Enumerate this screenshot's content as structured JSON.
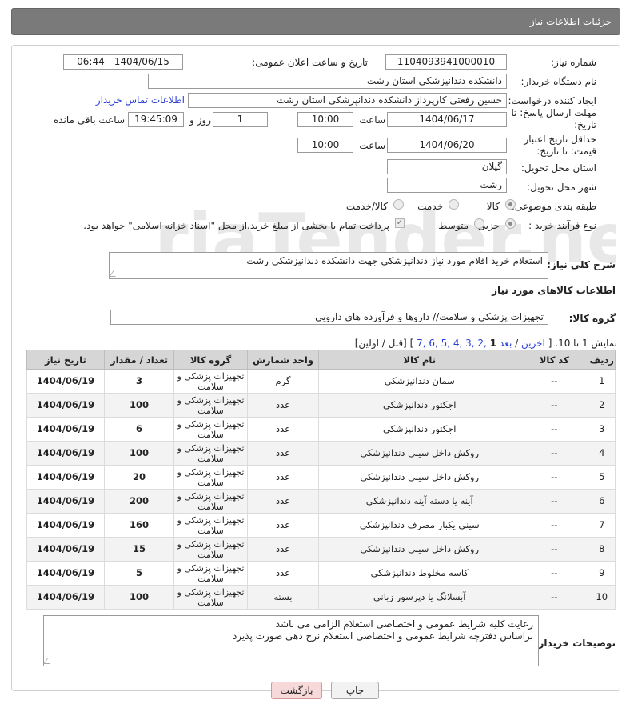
{
  "header": {
    "title": "جزئیات اطلاعات نیاز"
  },
  "form": {
    "need_number": {
      "label": "شماره نیاز:",
      "value": "1104093941000010"
    },
    "announce": {
      "label": "تاریخ و ساعت اعلان عمومی:",
      "value": "1404/06/15 - 06:44"
    },
    "buyer": {
      "label": "نام دستگاه خریدار:",
      "value": "دانشکده دندانپزشکی استان رشت"
    },
    "creator": {
      "label": "ایجاد کننده درخواست:",
      "value": "حسین رفعتی کارپرداز دانشکده دندانپزشکی استان رشت",
      "contact_link": "اطلاعات تماس خریدار"
    },
    "deadline": {
      "label": "مهلت ارسال پاسخ: تا تاریخ:",
      "date": "1404/06/17",
      "time_label": "ساعت",
      "time": "10:00",
      "days": "1",
      "days_label": "روز و",
      "remaining": "19:45:09",
      "remaining_label": "ساعت باقی مانده"
    },
    "price_valid": {
      "label": "حداقل تاریخ اعتبار قیمت: تا تاریخ:",
      "date": "1404/06/20",
      "time_label": "ساعت",
      "time": "10:00"
    },
    "province": {
      "label": "استان محل تحویل:",
      "value": "گیلان"
    },
    "city": {
      "label": "شهر محل تحویل:",
      "value": "رشت"
    },
    "category": {
      "label": "طبقه بندی موضوعی:",
      "opt1": "کالا",
      "opt2": "خدمت",
      "opt3": "کالا/خدمت"
    },
    "process": {
      "label": "نوع فرآیند خرید :",
      "opt1": "جزیی",
      "opt2": "متوسط",
      "payment_note": "پرداخت تمام یا بخشی از مبلغ خرید،از محل \"اسناد خزانه اسلامی\" خواهد بود."
    }
  },
  "summary": {
    "label": "شرح کلي نياز:",
    "value": "استعلام خرید اقلام مورد نیاز دندانپزشکی جهت دانشکده دندانپزشکی رشت"
  },
  "goods": {
    "section_title": "اطلاعات کالاهای مورد نیاز",
    "group_label": "گروه کالا:",
    "group_value": "تجهیزات پزشکی و سلامت// داروها و فرآورده های دارویی"
  },
  "pager": {
    "show_text": "نمایش 1 تا 10.",
    "open": "[",
    "last": "آخرین",
    "slash1": "/",
    "next": "بعد",
    "pages": "7, 6, 5, 4, 3, 2,",
    "current": "1",
    "close": "]",
    "prev_first": "[قبل / اولین]"
  },
  "table": {
    "headers": [
      "ردیف",
      "کد کالا",
      "نام کالا",
      "واحد شمارش",
      "گروه کالا",
      "تعداد / مقدار",
      "تاریخ نیاز"
    ],
    "rows": [
      [
        "1",
        "--",
        "سمان دندانپزشکی",
        "گرم",
        "تجهیزات پزشکی و سلامت",
        "3",
        "1404/06/19"
      ],
      [
        "2",
        "--",
        "اجکتور دندانپزشکی",
        "عدد",
        "تجهیزات پزشکی و سلامت",
        "100",
        "1404/06/19"
      ],
      [
        "3",
        "--",
        "اجکتور دندانپزشکی",
        "عدد",
        "تجهیزات پزشکی و سلامت",
        "6",
        "1404/06/19"
      ],
      [
        "4",
        "--",
        "روکش داخل سینی دندانپزشکی",
        "عدد",
        "تجهیزات پزشکی و سلامت",
        "100",
        "1404/06/19"
      ],
      [
        "5",
        "--",
        "روکش داخل سینی دندانپزشکی",
        "عدد",
        "تجهیزات پزشکی و سلامت",
        "20",
        "1404/06/19"
      ],
      [
        "6",
        "--",
        "آینه یا دسته آینه دندانپزشکی",
        "عدد",
        "تجهیزات پزشکی و سلامت",
        "200",
        "1404/06/19"
      ],
      [
        "7",
        "--",
        "سینی یکبار مصرف دندانپزشکی",
        "عدد",
        "تجهیزات پزشکی و سلامت",
        "160",
        "1404/06/19"
      ],
      [
        "8",
        "--",
        "روکش داخل سینی دندانپزشکی",
        "عدد",
        "تجهیزات پزشکی و سلامت",
        "15",
        "1404/06/19"
      ],
      [
        "9",
        "--",
        "کاسه مخلوط دندانپزشکی",
        "عدد",
        "تجهیزات پزشکی و سلامت",
        "5",
        "1404/06/19"
      ],
      [
        "10",
        "--",
        "آبسلانگ یا دپرسور زبانی",
        "بسته",
        "تجهیزات پزشکی و سلامت",
        "100",
        "1404/06/19"
      ]
    ]
  },
  "notes": {
    "label": "توضیحات خریدار:",
    "line1": "رعایت کلیه شرایط عمومی و اختصاصی استعلام الزامی می باشد",
    "line2": "براساس دفترچه شرایط عمومی و اختصاصی استعلام نرخ دهی صورت پذیرد"
  },
  "buttons": {
    "print": "چاپ",
    "back": "بازگشت"
  },
  "colors": {
    "header_bg": "#7a7a7a",
    "link": "#2a3fd6",
    "back_btn": "#f7d9d9"
  }
}
